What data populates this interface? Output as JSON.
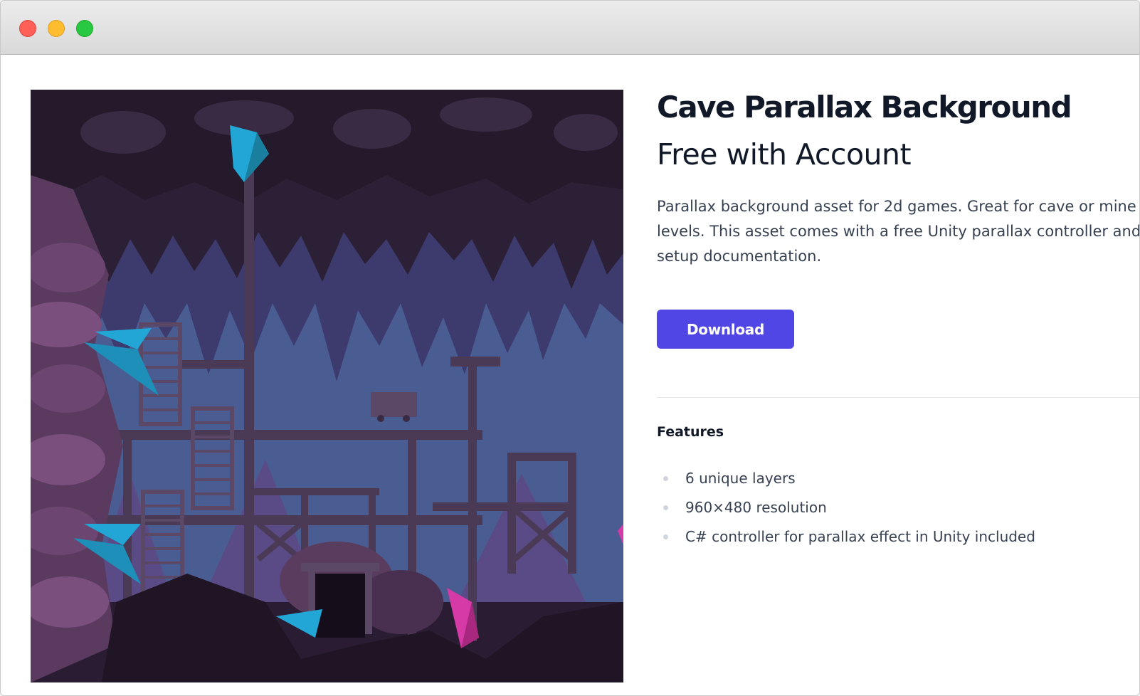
{
  "window": {
    "controls": [
      "close",
      "minimize",
      "zoom"
    ]
  },
  "product": {
    "title": "Cave Parallax Background",
    "price": "Free with Account",
    "description": "Parallax background asset for 2d games. Great for cave or mine levels. This asset comes with a free Unity parallax controller and setup documentation.",
    "download_label": "Download",
    "preview_icon": "pixel-art-cave-scene"
  },
  "features": {
    "heading": "Features",
    "items": [
      "6 unique layers",
      "960×480 resolution",
      "C# controller for parallax effect in Unity included"
    ]
  },
  "colors": {
    "accent": "#4f46e5",
    "title": "#111827",
    "body_text": "#374151"
  }
}
